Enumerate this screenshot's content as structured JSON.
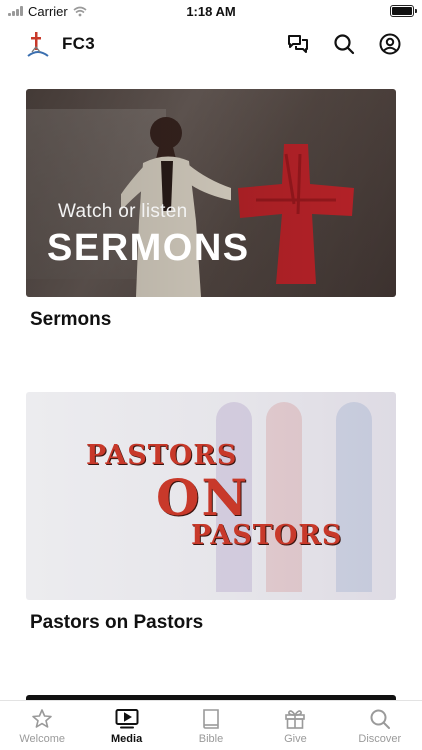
{
  "status_bar": {
    "carrier": "Carrier",
    "time": "1:18 AM"
  },
  "header": {
    "title": "FC3"
  },
  "cards": [
    {
      "title": "Sermons",
      "image_sub": "Watch or listen",
      "image_title": "SERMONS"
    },
    {
      "title": "Pastors on Pastors",
      "image_words": [
        "PASTORS",
        "ON",
        "PASTORS"
      ]
    }
  ],
  "tabs": [
    {
      "label": "Welcome",
      "icon": "star-icon",
      "active": false
    },
    {
      "label": "Media",
      "icon": "play-screen-icon",
      "active": true
    },
    {
      "label": "Bible",
      "icon": "book-icon",
      "active": false
    },
    {
      "label": "Give",
      "icon": "gift-icon",
      "active": false
    },
    {
      "label": "Discover",
      "icon": "search-icon",
      "active": false
    }
  ],
  "colors": {
    "accent_red": "#c8392a",
    "active_tab": "#111111",
    "inactive_tab": "#9a9a9a"
  }
}
